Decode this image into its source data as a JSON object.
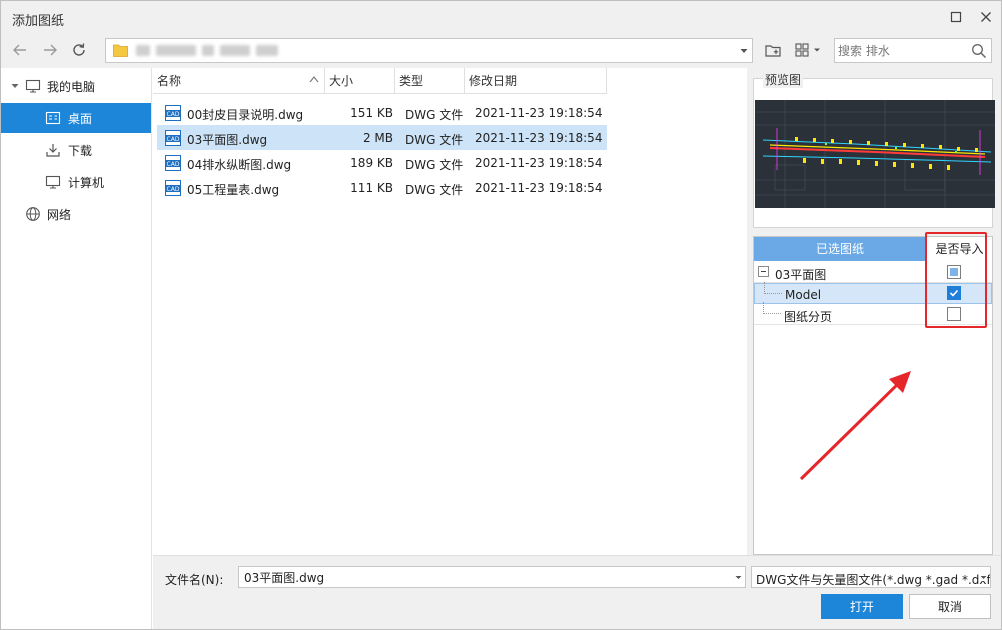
{
  "window": {
    "title": "添加图纸"
  },
  "toolbar": {
    "search_placeholder": "搜索 排水"
  },
  "sidebar": {
    "items": [
      {
        "label": "我的电脑",
        "icon": "monitor-icon"
      },
      {
        "label": "桌面",
        "icon": "desktop-icon"
      },
      {
        "label": "下载",
        "icon": "download-icon"
      },
      {
        "label": "计算机",
        "icon": "computer-icon"
      },
      {
        "label": "网络",
        "icon": "globe-icon"
      }
    ]
  },
  "filelist": {
    "columns": {
      "name": "名称",
      "size": "大小",
      "type": "类型",
      "date": "修改日期"
    },
    "rows": [
      {
        "name": "00封皮目录说明.dwg",
        "size": "151 KB",
        "type": "DWG 文件",
        "date": "2021-11-23 19:18:54"
      },
      {
        "name": "03平面图.dwg",
        "size": "2 MB",
        "type": "DWG 文件",
        "date": "2021-11-23 19:18:54"
      },
      {
        "name": "04排水纵断图.dwg",
        "size": "189 KB",
        "type": "DWG 文件",
        "date": "2021-11-23 19:18:54"
      },
      {
        "name": "05工程量表.dwg",
        "size": "111 KB",
        "type": "DWG 文件",
        "date": "2021-11-23 19:18:54"
      }
    ],
    "icon_label": "CAD"
  },
  "preview": {
    "label": "预览图"
  },
  "layers": {
    "header_selected": "已选图纸",
    "header_import": "是否导入",
    "rows": [
      {
        "label": "03平面图",
        "state": "partial"
      },
      {
        "label": "Model",
        "state": "checked"
      },
      {
        "label": "图纸分页",
        "state": "unchecked"
      }
    ]
  },
  "bottom": {
    "filename_label": "文件名(N):",
    "filename_value": "03平面图.dwg",
    "filetype_value": "DWG文件与矢量图文件(*.dwg *.gad *.dxf",
    "open_label": "打开",
    "cancel_label": "取消"
  },
  "colors": {
    "accent": "#1e86d8",
    "selection": "#cde3f7",
    "annotation": "#e5262b"
  }
}
